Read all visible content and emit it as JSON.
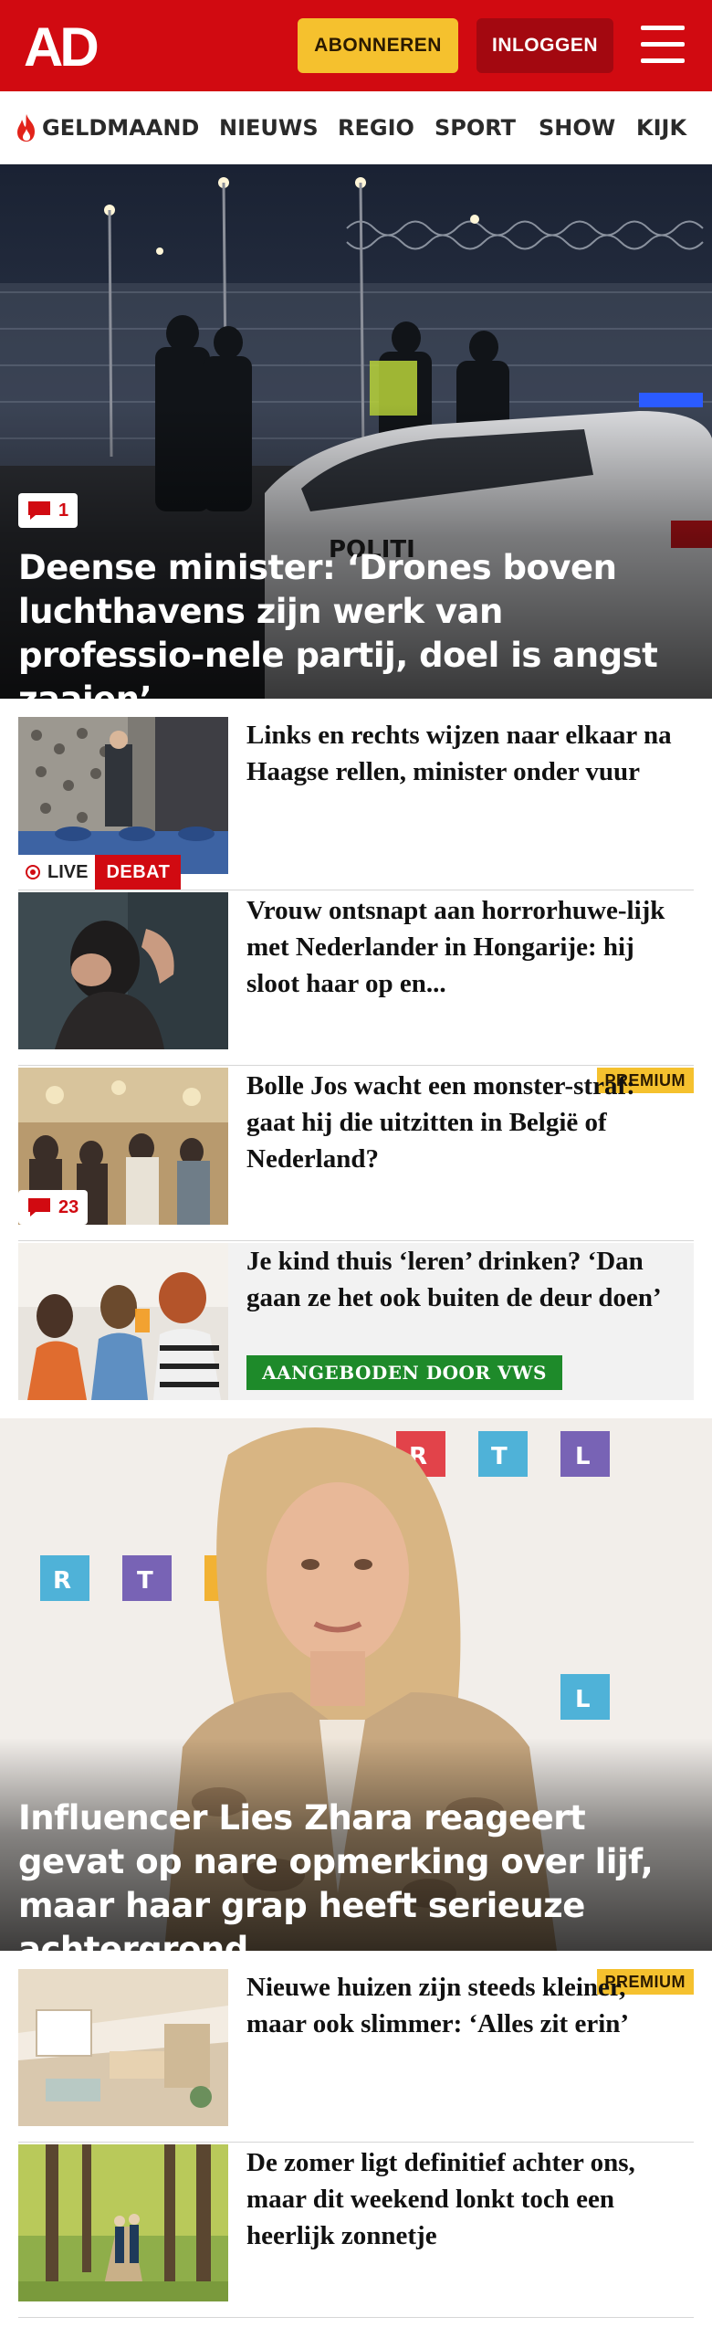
{
  "header": {
    "brand_colors": {
      "red": "#d10a11",
      "yellow": "#f5c12e",
      "dark_red": "#a30810"
    },
    "logo_text": "AD",
    "subscribe_label": "ABONNEREN",
    "login_label": "INLOGGEN",
    "menu_icon": "hamburger-menu-icon"
  },
  "nav": {
    "items": [
      {
        "label": "GELDMAAND",
        "icon": "flame-icon"
      },
      {
        "label": "NIEUWS"
      },
      {
        "label": "REGIO"
      },
      {
        "label": "SPORT"
      },
      {
        "label": "SHOW"
      },
      {
        "label": "KIJK"
      }
    ]
  },
  "hero1": {
    "title": "Deense minister: ‘Drones boven luchthavens zijn werk van professio-nele partij, doel is angst zaaien’",
    "comments": "1"
  },
  "articles": [
    {
      "title": "Links en rechts wijzen naar elkaar na Haagse rellen, minister onder vuur",
      "live_label": "LIVE",
      "tag_label": "DEBAT"
    },
    {
      "title": "Vrouw ontsnapt aan horrorhuwe-lijk met Nederlander in Hongarije: hij sloot haar op en..."
    },
    {
      "title": "Bolle Jos wacht een monster-straf: gaat hij die uitzitten in België of Nederland?",
      "premium_label": "PREMIUM",
      "comments": "23"
    },
    {
      "title": "Je kind thuis ‘leren’ drinken? ‘Dan gaan ze het ook buiten de deur doen’",
      "sponsor_label": "AANGEBODEN DOOR VWS"
    }
  ],
  "hero2": {
    "title": "Influencer Lies Zhara reageert gevat op nare opmerking over lijf, maar haar grap heeft serieuze achtergrond",
    "backdrop_text": "RTL"
  },
  "articles2": [
    {
      "title": "Nieuwe huizen zijn steeds kleiner, maar ook slimmer: ‘Alles zit erin’",
      "premium_label": "PREMIUM"
    },
    {
      "title": "De zomer ligt definitief achter ons, maar dit weekend lonkt toch een heerlijk zonnetje"
    }
  ]
}
